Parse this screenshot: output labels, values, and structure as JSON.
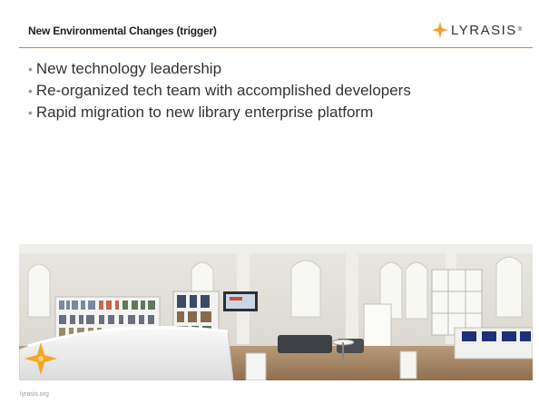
{
  "slide": {
    "title": "New Environmental Changes (trigger)",
    "logo_text": "LYRASIS",
    "logo_tm": "®",
    "bullets": [
      "New technology leadership",
      "Re-organized tech team with accomplished developers",
      "Rapid migration to new library enterprise platform"
    ],
    "footer": "lyrasis.org"
  },
  "colors": {
    "accent": "#e07f22",
    "star_gold": "#f5a623",
    "text": "#333333"
  },
  "icons": {
    "logo_mark": "four-point-star-icon",
    "photo_mark": "four-point-star-icon"
  }
}
